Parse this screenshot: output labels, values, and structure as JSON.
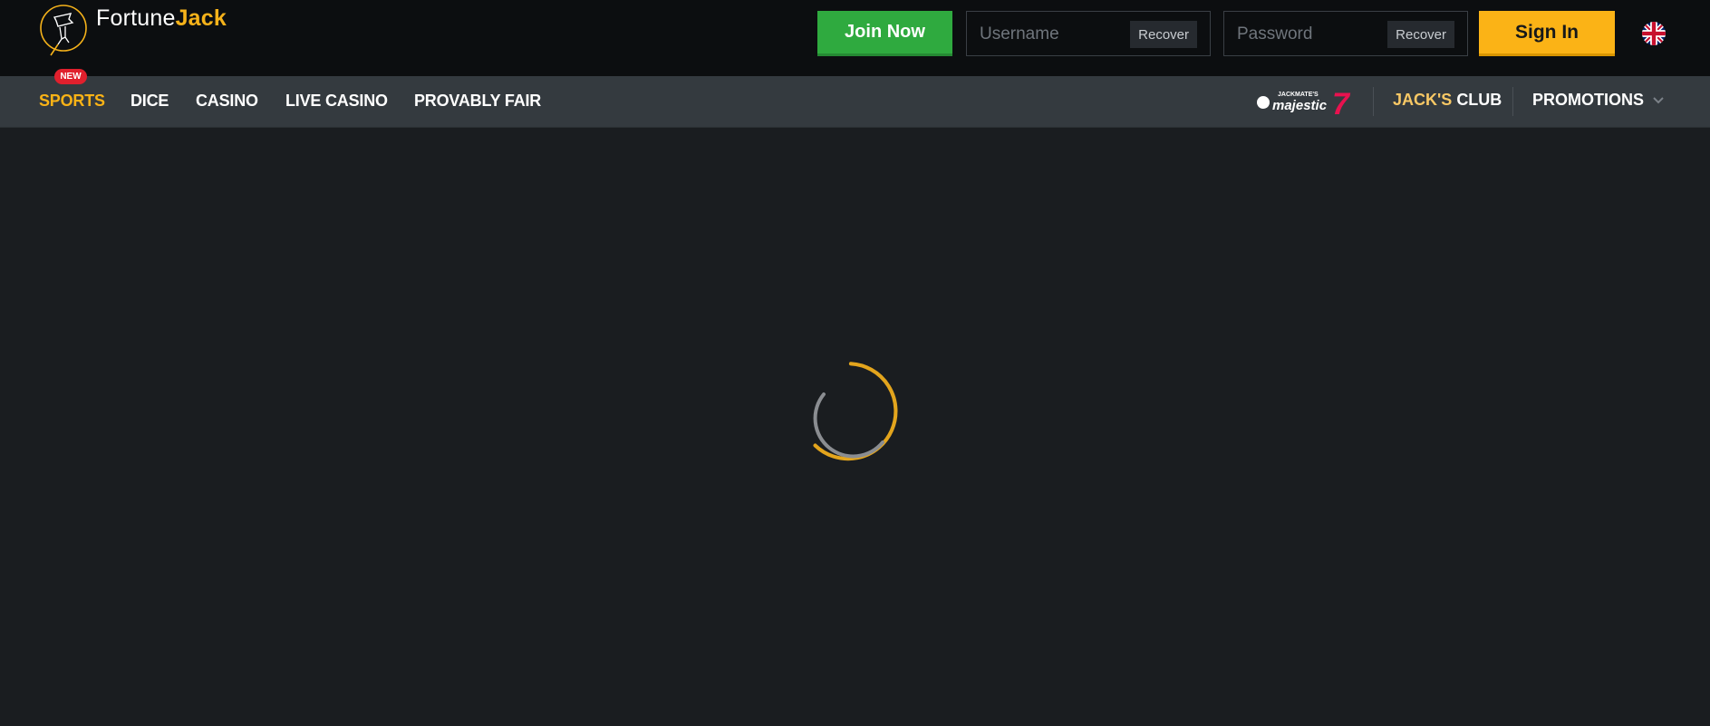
{
  "brand": {
    "name_part1": "Fortune",
    "name_part2": "Jack"
  },
  "header": {
    "join_label": "Join Now",
    "username_placeholder": "Username",
    "password_placeholder": "Password",
    "recover_label": "Recover",
    "signin_label": "Sign In",
    "language_icon": "uk-flag-icon"
  },
  "nav": {
    "items": [
      {
        "label": "SPORTS",
        "active": true,
        "badge": "NEW"
      },
      {
        "label": "DICE"
      },
      {
        "label": "CASINO"
      },
      {
        "label": "LIVE CASINO"
      },
      {
        "label": "PROVABLY FAIR"
      }
    ],
    "majestic_logo": {
      "top_text": "JACKMATE'S",
      "main_text": "majestic",
      "number": "7"
    },
    "jacks_club_part1": "JACK'S",
    "jacks_club_part2": "CLUB",
    "promotions_label": "PROMOTIONS"
  },
  "colors": {
    "accent": "#fbb316",
    "join": "#2faa3f",
    "badge": "#e0202d",
    "background": "#1a1d20"
  },
  "main": {
    "loading_icon": "loading-spinner-icon"
  }
}
